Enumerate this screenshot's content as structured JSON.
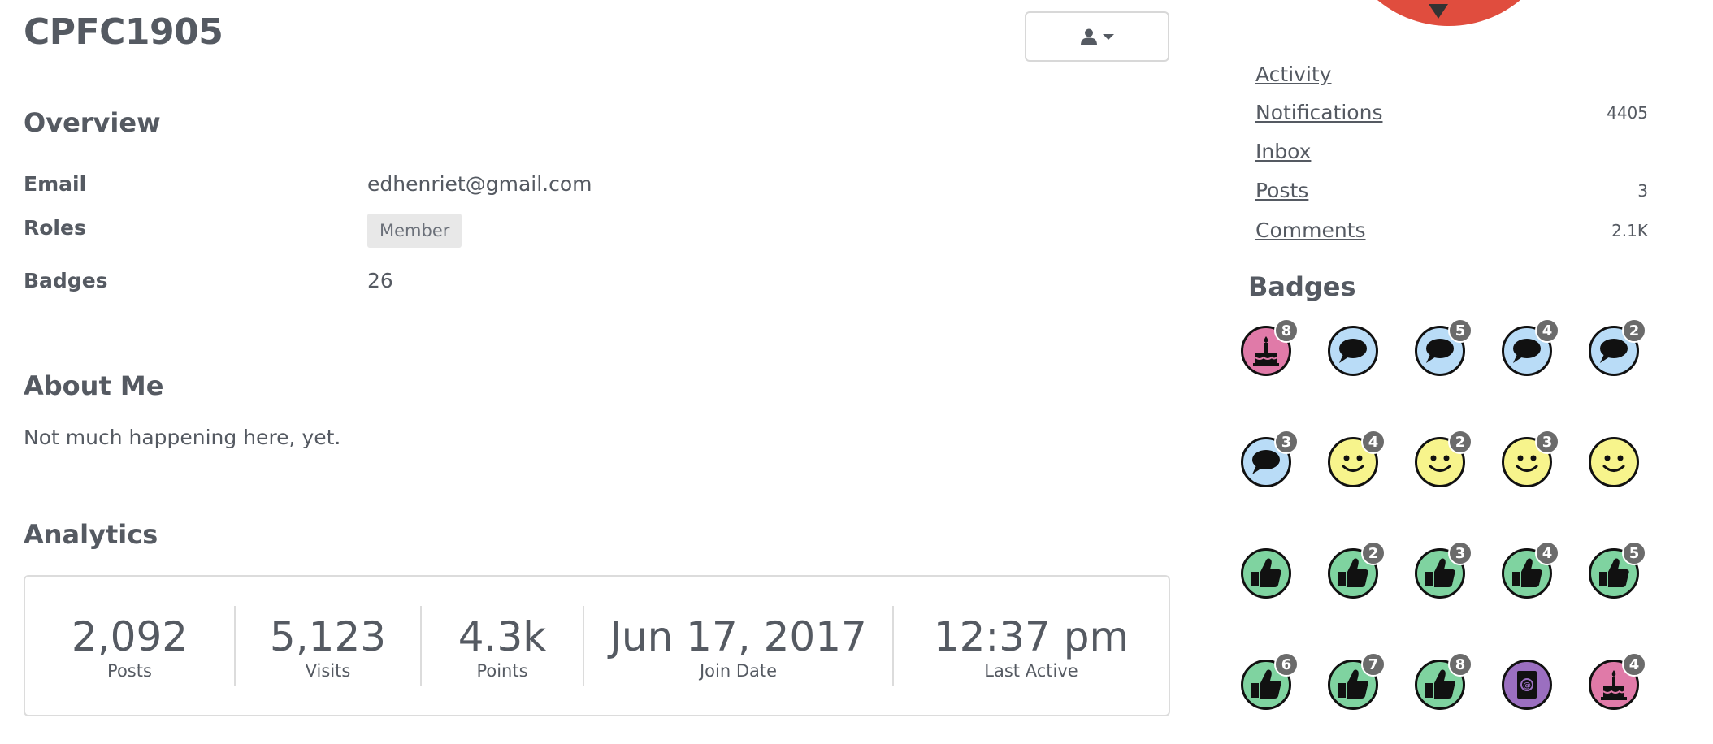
{
  "profile": {
    "username": "CPFC1905"
  },
  "overview": {
    "title": "Overview",
    "email_label": "Email",
    "email_value": "edhenriet@gmail.com",
    "roles_label": "Roles",
    "role": "Member",
    "badges_label": "Badges",
    "badges_value": "26"
  },
  "about": {
    "title": "About Me",
    "text": "Not much happening here, yet."
  },
  "analytics": {
    "title": "Analytics",
    "stats": [
      {
        "value": "2,092",
        "label": "Posts"
      },
      {
        "value": "5,123",
        "label": "Visits"
      },
      {
        "value": "4.3k",
        "label": "Points"
      },
      {
        "value": "Jun 17, 2017",
        "label": "Join Date"
      },
      {
        "value": "12:37 pm",
        "label": "Last Active"
      }
    ]
  },
  "sidebar": {
    "links": [
      {
        "label": "Activity",
        "count": ""
      },
      {
        "label": "Notifications",
        "count": "4405"
      },
      {
        "label": "Inbox",
        "count": ""
      },
      {
        "label": "Posts",
        "count": "3"
      },
      {
        "label": "Comments",
        "count": "2.1K"
      }
    ],
    "badges_title": "Badges",
    "badges": [
      {
        "icon": "cake-icon",
        "color": "#e07aa8",
        "count": "8"
      },
      {
        "icon": "speech-bubble-icon",
        "color": "#b9dcf7",
        "count": ""
      },
      {
        "icon": "speech-bubble-icon",
        "color": "#b9dcf7",
        "count": "5"
      },
      {
        "icon": "speech-bubble-icon",
        "color": "#b9dcf7",
        "count": "4"
      },
      {
        "icon": "speech-bubble-icon",
        "color": "#b9dcf7",
        "count": "2"
      },
      {
        "icon": "speech-bubble-icon",
        "color": "#b9dcf7",
        "count": "3"
      },
      {
        "icon": "smiley-icon",
        "color": "#f7f48c",
        "count": "4"
      },
      {
        "icon": "smiley-icon",
        "color": "#f7f48c",
        "count": "2"
      },
      {
        "icon": "smiley-icon",
        "color": "#f7f48c",
        "count": "3"
      },
      {
        "icon": "smiley-icon",
        "color": "#f7f48c",
        "count": ""
      },
      {
        "icon": "thumbs-up-icon",
        "color": "#7fd3a0",
        "count": ""
      },
      {
        "icon": "thumbs-up-icon",
        "color": "#7fd3a0",
        "count": "2"
      },
      {
        "icon": "thumbs-up-icon",
        "color": "#7fd3a0",
        "count": "3"
      },
      {
        "icon": "thumbs-up-icon",
        "color": "#7fd3a0",
        "count": "4"
      },
      {
        "icon": "thumbs-up-icon",
        "color": "#7fd3a0",
        "count": "5"
      },
      {
        "icon": "thumbs-up-icon",
        "color": "#7fd3a0",
        "count": "6"
      },
      {
        "icon": "thumbs-up-icon",
        "color": "#7fd3a0",
        "count": "7"
      },
      {
        "icon": "thumbs-up-icon",
        "color": "#7fd3a0",
        "count": "8"
      },
      {
        "icon": "address-book-icon",
        "color": "#9b6fc0",
        "count": ""
      },
      {
        "icon": "cake-icon",
        "color": "#e07aa8",
        "count": "4"
      }
    ]
  }
}
